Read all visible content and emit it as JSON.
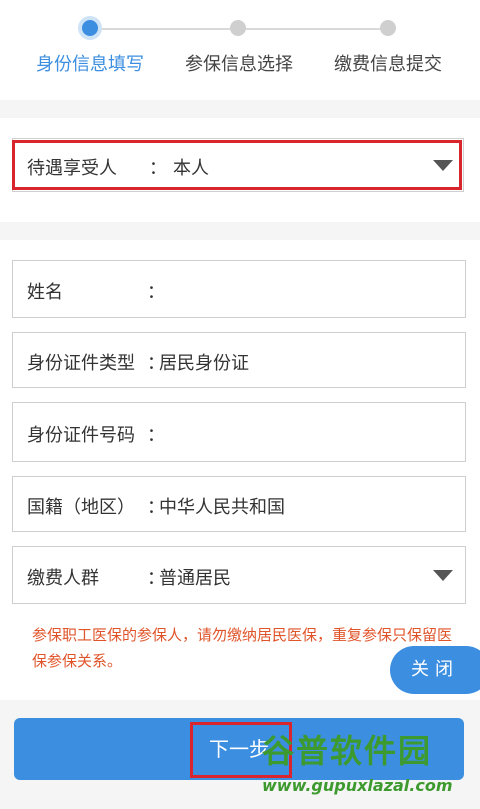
{
  "steps": [
    {
      "label": "身份信息填写",
      "active": true
    },
    {
      "label": "参保信息选择",
      "active": false
    },
    {
      "label": "缴费信息提交",
      "active": false
    }
  ],
  "beneficiary": {
    "label": "待遇享受人",
    "colon": "：",
    "value": "本人"
  },
  "fields": {
    "name": {
      "label": "姓名",
      "colon": "：",
      "value": ""
    },
    "id_type": {
      "label": "身份证件类型",
      "colon": "：",
      "value": "居民身份证"
    },
    "id_number": {
      "label": "身份证件号码",
      "colon": "：",
      "value": ""
    },
    "nationality": {
      "label": "国籍（地区）",
      "colon": "：",
      "value": "中华人民共和国"
    },
    "payer_group": {
      "label": "缴费人群",
      "colon": "：",
      "value": "普通居民"
    }
  },
  "notice": {
    "text": "参保职工医保的参保人，请勿缴纳居民医保，重复参保只保留医保参保关系。"
  },
  "close_button": {
    "label": "关闭"
  },
  "next_button": {
    "label": "下一步"
  },
  "watermark": {
    "title": "谷普软件园",
    "url": "www.gupuxlazal.com"
  },
  "colors": {
    "accent": "#3b8ee0",
    "highlight": "#d9262e",
    "notice": "#e0542a",
    "watermark": "#3d9a2e"
  }
}
